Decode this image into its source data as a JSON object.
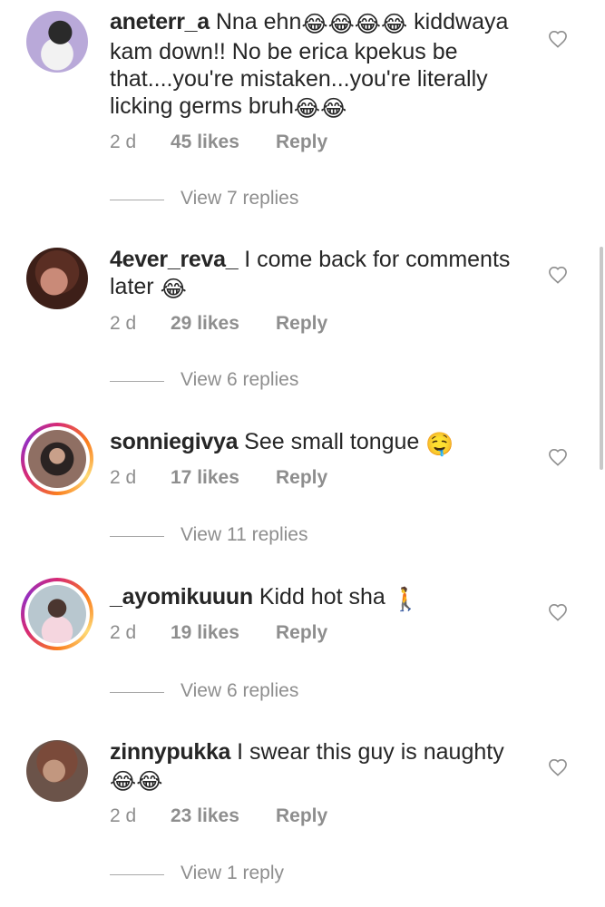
{
  "comments": [
    {
      "username": "aneterr_a",
      "text_parts": [
        "Nna ehn",
        " kiddwaya kam down!! No be erica kpekus be that....you're mistaken...you're literally licking germs bruh"
      ],
      "emoji_1": "😂😂😂😂",
      "emoji_2": "😂😂",
      "time": "2 d",
      "likes": "45 likes",
      "reply": "Reply",
      "view_replies": "View 7 replies",
      "story_ring": false
    },
    {
      "username": "4ever_reva_",
      "text": "I come back for comments later",
      "emoji": "😂",
      "time": "2 d",
      "likes": "29 likes",
      "reply": "Reply",
      "view_replies": "View 6 replies",
      "story_ring": false
    },
    {
      "username": "sonniegivya",
      "text": "See small tongue",
      "emoji": "🤤",
      "time": "2 d",
      "likes": "17 likes",
      "reply": "Reply",
      "view_replies": "View 11 replies",
      "story_ring": true
    },
    {
      "username": "_ayomikuuun",
      "text": "Kidd hot sha",
      "emoji": "🚶",
      "time": "2 d",
      "likes": "19 likes",
      "reply": "Reply",
      "view_replies": "View 6 replies",
      "story_ring": true
    },
    {
      "username": "zinnypukka",
      "text": "I swear this guy is naughty",
      "emoji": "😂😂",
      "time": "2 d",
      "likes": "23 likes",
      "reply": "Reply",
      "view_replies": "View 1 reply",
      "story_ring": false
    }
  ],
  "icons": {
    "like": "heart-outline-icon"
  },
  "colors": {
    "text_primary": "#262626",
    "text_secondary": "#8e8e8e",
    "story_ring_start": "#d62976",
    "story_ring_end": "#fa7e1e"
  }
}
